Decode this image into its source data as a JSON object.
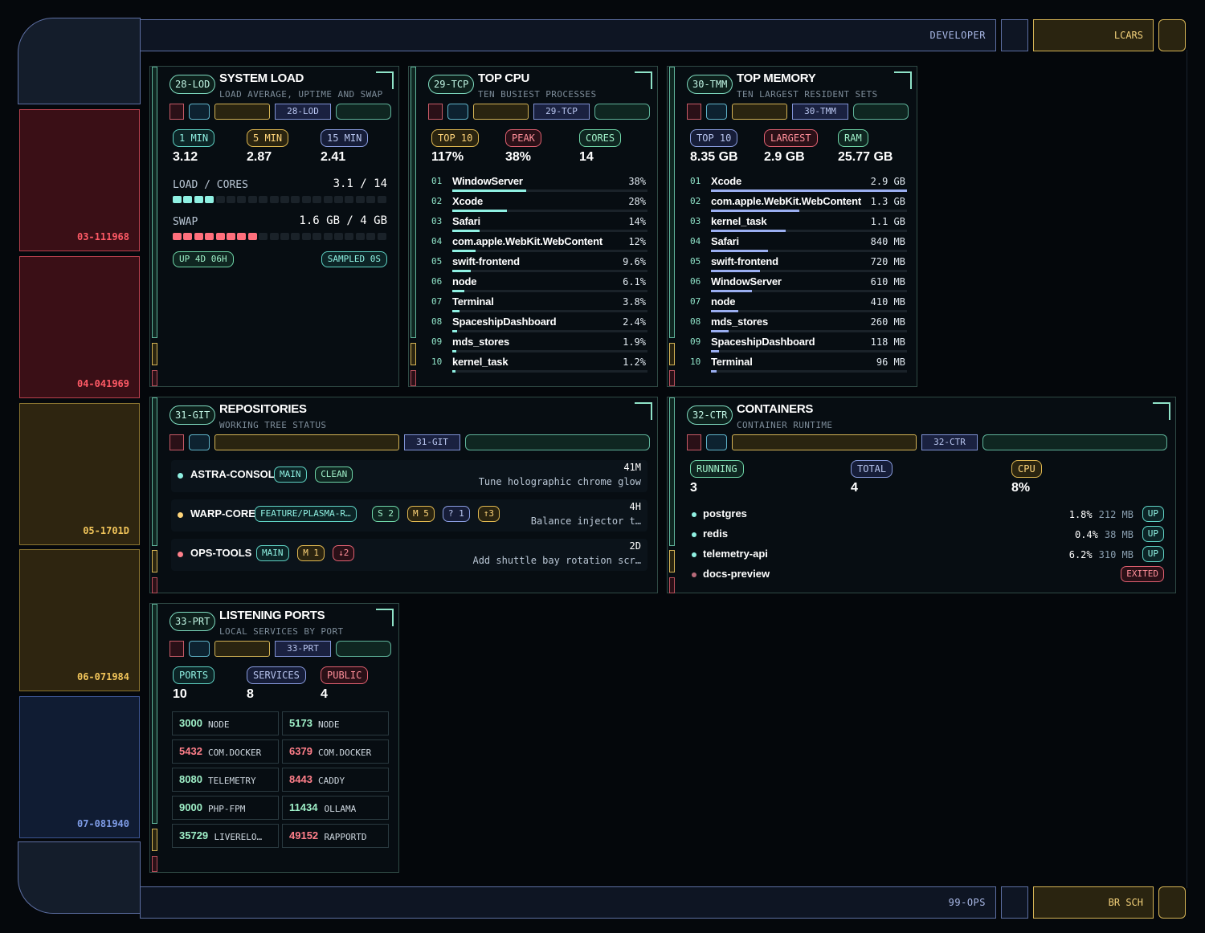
{
  "header": {
    "title": "DEVELOPER",
    "button": "LCARS"
  },
  "footer": {
    "title": "99-OPS",
    "button": "BR SCH"
  },
  "sidebar": [
    {
      "label": "03-111968",
      "color": "#ff5a66"
    },
    {
      "label": "04-041969",
      "color": "#ff5a66"
    },
    {
      "label": "05-1701D",
      "color": "#f2c55a"
    },
    {
      "label": "06-071984",
      "color": "#f2c55a"
    },
    {
      "label": "07-081940",
      "color": "#7f9de8"
    }
  ],
  "load": {
    "code": "28-LOD",
    "title": "SYSTEM LOAD",
    "subtitle": "LOAD AVERAGE, UPTIME AND SWAP",
    "tags": [
      "1 MIN",
      "5 MIN",
      "15 MIN"
    ],
    "values": [
      "3.12",
      "2.87",
      "2.41"
    ],
    "load_label": "LOAD / CORES",
    "load_value": "3.1 / 14",
    "swap_label": "SWAP",
    "swap_value": "1.6 GB / 4 GB",
    "uptime": "UP 4D 06H",
    "sampled": "SAMPLED 0S",
    "load_fraction": 0.22,
    "swap_fraction": 0.4
  },
  "cpu": {
    "code": "29-TCP",
    "title": "TOP CPU",
    "subtitle": "TEN BUSIEST PROCESSES",
    "tags": [
      "TOP 10",
      "PEAK",
      "CORES"
    ],
    "values": [
      "117%",
      "38%",
      "14"
    ],
    "rows": [
      {
        "n": "01",
        "name": "WindowServer",
        "v": "38%",
        "f": 0.38
      },
      {
        "n": "02",
        "name": "Xcode",
        "v": "28%",
        "f": 0.28
      },
      {
        "n": "03",
        "name": "Safari",
        "v": "14%",
        "f": 0.14
      },
      {
        "n": "04",
        "name": "com.apple.WebKit.WebContent",
        "v": "12%",
        "f": 0.12
      },
      {
        "n": "05",
        "name": "swift-frontend",
        "v": "9.6%",
        "f": 0.096
      },
      {
        "n": "06",
        "name": "node",
        "v": "6.1%",
        "f": 0.061
      },
      {
        "n": "07",
        "name": "Terminal",
        "v": "3.8%",
        "f": 0.038
      },
      {
        "n": "08",
        "name": "SpaceshipDashboard",
        "v": "2.4%",
        "f": 0.024
      },
      {
        "n": "09",
        "name": "mds_stores",
        "v": "1.9%",
        "f": 0.019
      },
      {
        "n": "10",
        "name": "kernel_task",
        "v": "1.2%",
        "f": 0.012
      }
    ]
  },
  "mem": {
    "code": "30-TMM",
    "title": "TOP MEMORY",
    "subtitle": "TEN LARGEST RESIDENT SETS",
    "tags": [
      "TOP 10",
      "LARGEST",
      "RAM"
    ],
    "values": [
      "8.35 GB",
      "2.9 GB",
      "25.77 GB"
    ],
    "rows": [
      {
        "n": "01",
        "name": "Xcode",
        "v": "2.9 GB",
        "f": 1.0
      },
      {
        "n": "02",
        "name": "com.apple.WebKit.WebContent",
        "v": "1.3 GB",
        "f": 0.45
      },
      {
        "n": "03",
        "name": "kernel_task",
        "v": "1.1 GB",
        "f": 0.38
      },
      {
        "n": "04",
        "name": "Safari",
        "v": "840 MB",
        "f": 0.29
      },
      {
        "n": "05",
        "name": "swift-frontend",
        "v": "720 MB",
        "f": 0.25
      },
      {
        "n": "06",
        "name": "WindowServer",
        "v": "610 MB",
        "f": 0.21
      },
      {
        "n": "07",
        "name": "node",
        "v": "410 MB",
        "f": 0.14
      },
      {
        "n": "08",
        "name": "mds_stores",
        "v": "260 MB",
        "f": 0.09
      },
      {
        "n": "09",
        "name": "SpaceshipDashboard",
        "v": "118 MB",
        "f": 0.04
      },
      {
        "n": "10",
        "name": "Terminal",
        "v": "96 MB",
        "f": 0.03
      }
    ]
  },
  "git": {
    "code": "31-GIT",
    "title": "REPOSITORIES",
    "subtitle": "WORKING TREE STATUS",
    "repos": [
      {
        "name": "ASTRA-CONSOLE",
        "dot": "#8ff0e2",
        "tags": [
          {
            "t": "MAIN",
            "c": "teal"
          },
          {
            "t": "CLEAN",
            "c": "grn"
          }
        ],
        "age": "41M",
        "msg": "Tune holographic chrome glow"
      },
      {
        "name": "WARP-CORE",
        "dot": "#ffd57a",
        "tags": [
          {
            "t": "FEATURE/PLASMA-R…",
            "c": "teal"
          },
          {
            "t": "S 2",
            "c": "grn"
          },
          {
            "t": "M 5",
            "c": "yel"
          },
          {
            "t": "? 1",
            "c": "blu"
          },
          {
            "t": "↑3",
            "c": "yel"
          }
        ],
        "age": "4H",
        "msg": "Balance injector t…"
      },
      {
        "name": "OPS-TOOLS",
        "dot": "#ff7f8a",
        "tags": [
          {
            "t": "MAIN",
            "c": "teal"
          },
          {
            "t": "M 1",
            "c": "yel"
          },
          {
            "t": "↓2",
            "c": "red"
          }
        ],
        "age": "2D",
        "msg": "Add shuttle bay rotation scr…"
      }
    ]
  },
  "ctr": {
    "code": "32-CTR",
    "title": "CONTAINERS",
    "subtitle": "CONTAINER RUNTIME",
    "tags": [
      "RUNNING",
      "TOTAL",
      "CPU"
    ],
    "values": [
      "3",
      "4",
      "8%"
    ],
    "rows": [
      {
        "name": "postgres",
        "cpu": "1.8%",
        "mem": "212 MB",
        "state": "UP",
        "dot": "#8ff0e2"
      },
      {
        "name": "redis",
        "cpu": "0.4%",
        "mem": "38 MB",
        "state": "UP",
        "dot": "#8ff0e2"
      },
      {
        "name": "telemetry-api",
        "cpu": "6.2%",
        "mem": "310 MB",
        "state": "UP",
        "dot": "#8ff0e2"
      },
      {
        "name": "docs-preview",
        "cpu": "",
        "mem": "",
        "state": "EXITED",
        "dot": "#b86a7a"
      }
    ]
  },
  "ports": {
    "code": "33-PRT",
    "title": "LISTENING PORTS",
    "subtitle": "LOCAL SERVICES BY PORT",
    "tags": [
      "PORTS",
      "SERVICES",
      "PUBLIC"
    ],
    "values": [
      "10",
      "8",
      "4"
    ],
    "items": [
      {
        "port": "3000",
        "proc": "NODE",
        "public": false
      },
      {
        "port": "5173",
        "proc": "NODE",
        "public": false
      },
      {
        "port": "5432",
        "proc": "COM.DOCKER",
        "public": true
      },
      {
        "port": "6379",
        "proc": "COM.DOCKER",
        "public": true
      },
      {
        "port": "8080",
        "proc": "TELEMETRY",
        "public": false
      },
      {
        "port": "8443",
        "proc": "CADDY",
        "public": true
      },
      {
        "port": "9000",
        "proc": "PHP-FPM",
        "public": false
      },
      {
        "port": "11434",
        "proc": "OLLAMA",
        "public": false
      },
      {
        "port": "35729",
        "proc": "LIVERELO…",
        "public": false
      },
      {
        "port": "49152",
        "proc": "RAPPORTD",
        "public": true
      }
    ]
  }
}
